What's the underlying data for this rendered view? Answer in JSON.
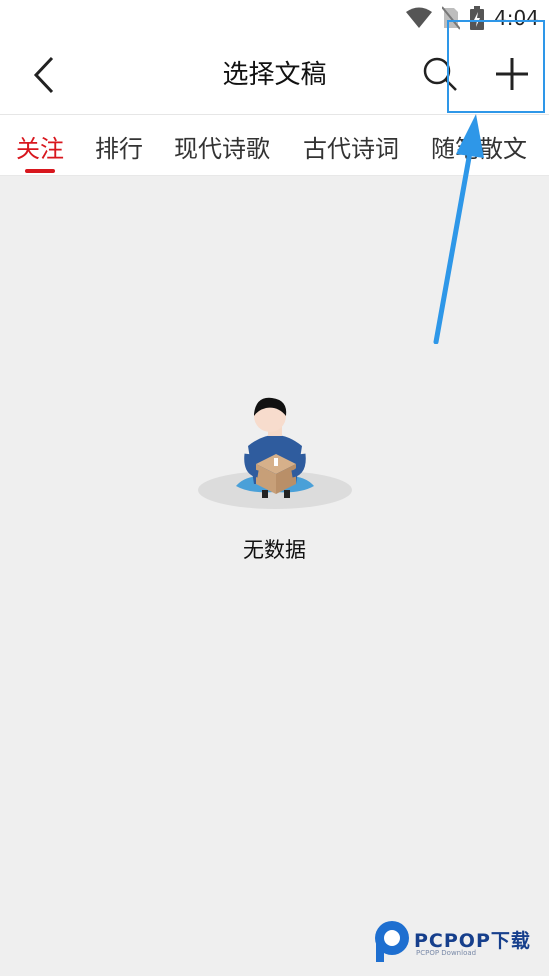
{
  "status_bar": {
    "time": "4:04",
    "icons": [
      "wifi-icon",
      "no-sim-icon",
      "battery-charging-icon"
    ]
  },
  "app_bar": {
    "title": "选择文稿",
    "back_icon": "back-chevron-icon",
    "search_icon": "search-icon",
    "add_icon": "plus-icon"
  },
  "tabs": [
    {
      "label": "关注",
      "active": true
    },
    {
      "label": "排行",
      "active": false
    },
    {
      "label": "现代诗歌",
      "active": false
    },
    {
      "label": "古代诗词",
      "active": false
    },
    {
      "label": "随笔散文",
      "active": false
    }
  ],
  "empty_state": {
    "text": "无数据",
    "illustration": "person-with-box-illustration"
  },
  "annotation": {
    "highlight_color": "#2e97e8",
    "target": "plus-icon"
  },
  "watermark": {
    "text": "PCPOP下载",
    "subtext": "PCPOP Download"
  },
  "colors": {
    "accent": "#d8171e",
    "background": "#efefef",
    "annotation_blue": "#2e97e8"
  }
}
